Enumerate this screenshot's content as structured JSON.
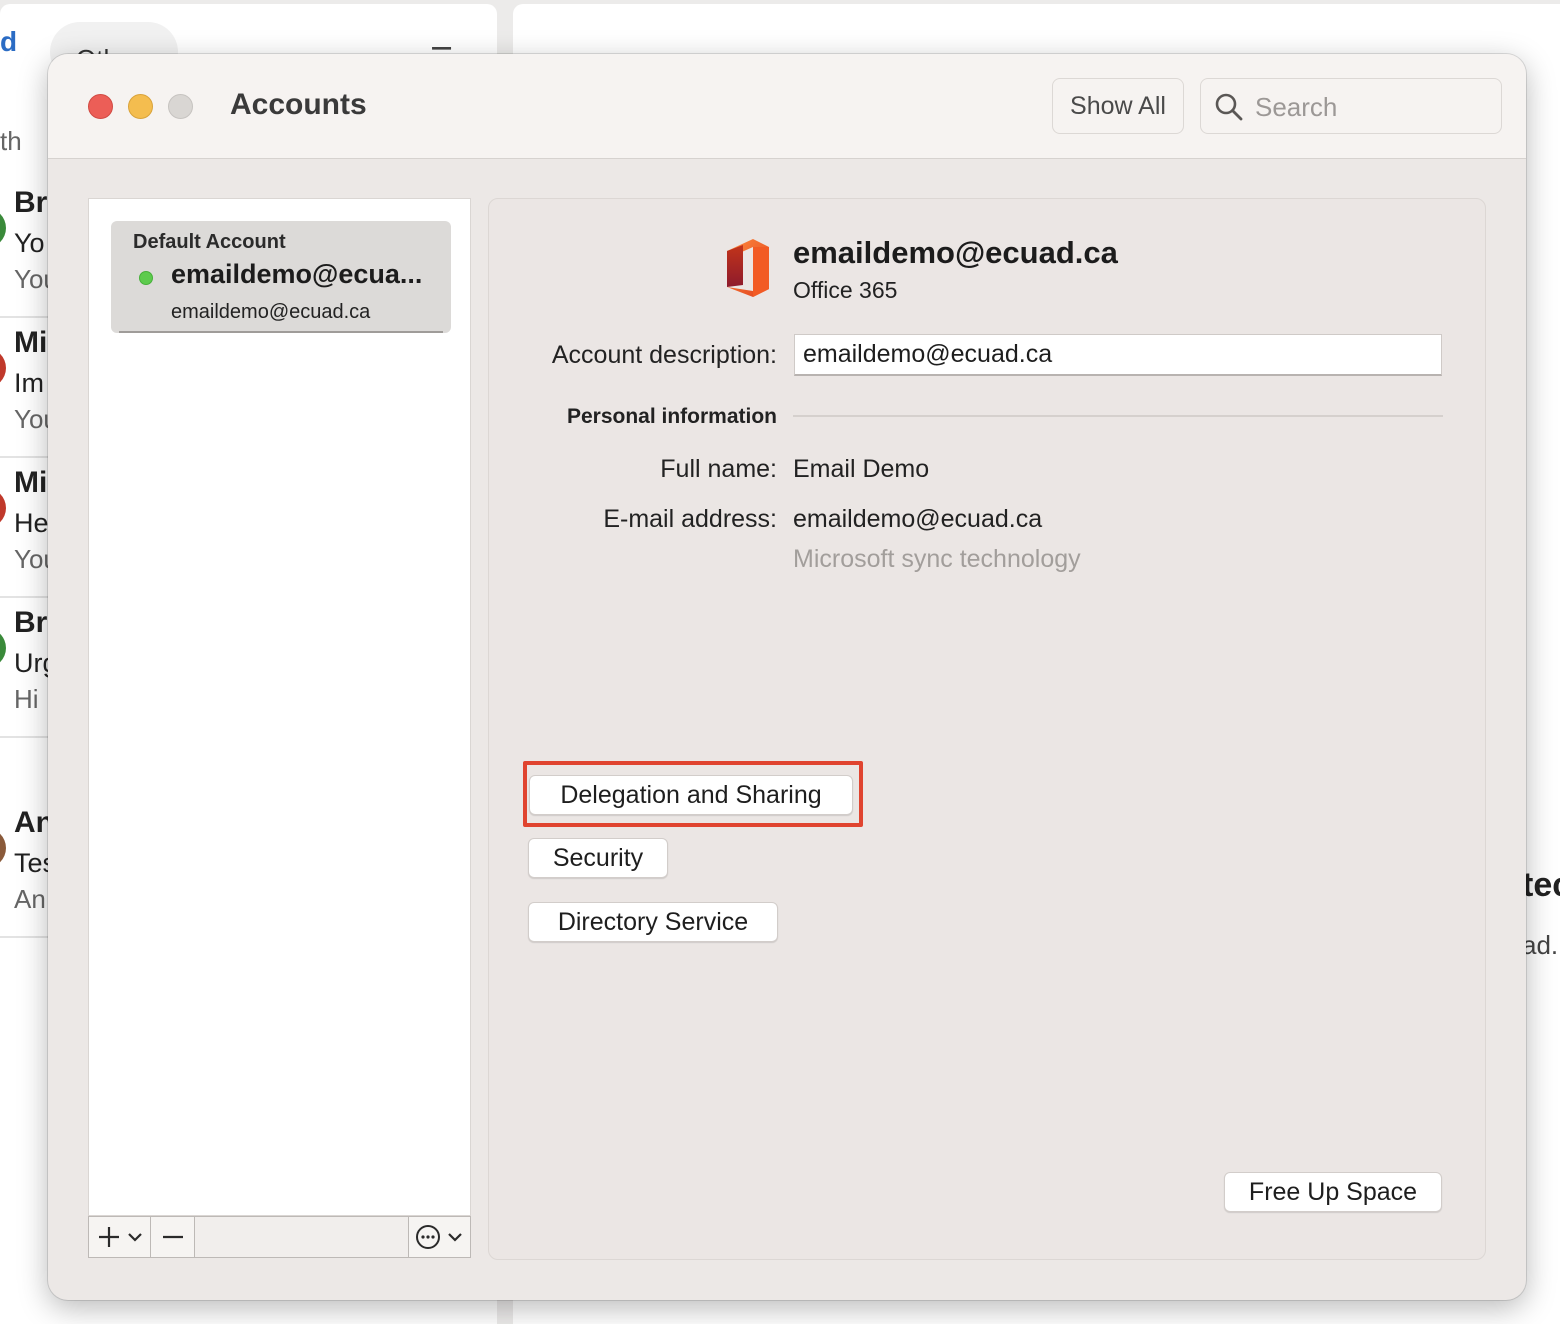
{
  "background_app": {
    "tab_focused_fragment": "d",
    "tab_other_label": "Other",
    "filter_icon": "filter-lines-icon",
    "search_fragment": "th",
    "messages": [
      {
        "line1": "Br",
        "line2": "Yo",
        "line3": "You",
        "avatar_color": "#3a8a3a"
      },
      {
        "line1": "Mi",
        "line2": "Im",
        "line3": "You",
        "avatar_color": "#c0392b"
      },
      {
        "line1": "Mi",
        "line2": "He",
        "line3": "You",
        "avatar_color": "#c0392b"
      },
      {
        "line1": "Br",
        "line2": "Urg",
        "line3": "Hi",
        "avatar_color": "#3a8a3a"
      },
      {
        "line1": "An",
        "line2": "Tes",
        "line3": "An",
        "avatar_color": "#8a5a3a"
      }
    ],
    "right_fragment_1": "tec",
    "right_fragment_2": "ad."
  },
  "window": {
    "title": "Accounts",
    "show_all_label": "Show All",
    "search_placeholder": "Search"
  },
  "accounts_list": {
    "items": [
      {
        "header": "Default Account",
        "name": "emaildemo@ecua...",
        "email": "emaildemo@ecuad.ca",
        "status_color": "#5dcb4d"
      }
    ],
    "tools": {
      "add_icon": "plus-chevron-icon",
      "remove_icon": "minus-icon",
      "more_icon": "ellipsis-circle-chevron-icon"
    }
  },
  "detail": {
    "account_title": "emaildemo@ecuad.ca",
    "account_type": "Office 365",
    "description_label": "Account description:",
    "description_value": "emaildemo@ecuad.ca",
    "personal_info_label": "Personal information",
    "full_name_label": "Full name:",
    "full_name_value": "Email Demo",
    "email_label": "E-mail address:",
    "email_value": "emaildemo@ecuad.ca",
    "sync_value": "Microsoft sync technology",
    "buttons": {
      "delegation": "Delegation and Sharing",
      "security": "Security",
      "directory": "Directory Service",
      "free_up": "Free Up Space"
    },
    "highlight_color": "#e0442f"
  }
}
